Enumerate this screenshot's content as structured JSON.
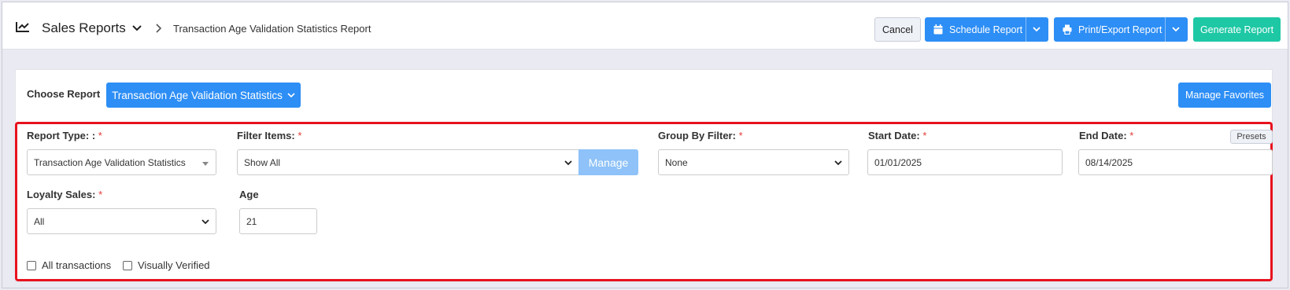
{
  "header": {
    "section_title": "Sales Reports",
    "page_title": "Transaction Age Validation Statistics Report",
    "buttons": {
      "cancel": "Cancel",
      "schedule": "Schedule Report",
      "print_export": "Print/Export Report",
      "generate": "Generate Report"
    }
  },
  "report_picker": {
    "label": "Choose Report",
    "selected": "Transaction Age Validation Statistics",
    "favorites_button": "Manage Favorites"
  },
  "filters": {
    "report_type": {
      "label": "Report Type: :",
      "required": "*",
      "value": "Transaction Age Validation Statistics"
    },
    "filter_items": {
      "label": "Filter Items:",
      "required": "*",
      "value": "Show All",
      "manage_button": "Manage"
    },
    "group_by": {
      "label": "Group By Filter:",
      "required": "*",
      "value": "None"
    },
    "start_date": {
      "label": "Start Date:",
      "required": "*",
      "value": "01/01/2025"
    },
    "end_date": {
      "label": "End Date:",
      "required": "*",
      "value": "08/14/2025",
      "presets_button": "Presets"
    },
    "loyalty_sales": {
      "label": "Loyalty Sales:",
      "required": "*",
      "value": "All"
    },
    "age": {
      "label": "Age",
      "value": "21"
    },
    "checkboxes": [
      {
        "label": "All transactions",
        "checked": false
      },
      {
        "label": "Visually Verified",
        "checked": false
      }
    ]
  },
  "colors": {
    "primary": "#2d8ef5",
    "success": "#1ec8a5",
    "highlight_border": "#e8121e",
    "required": "#e53935"
  }
}
